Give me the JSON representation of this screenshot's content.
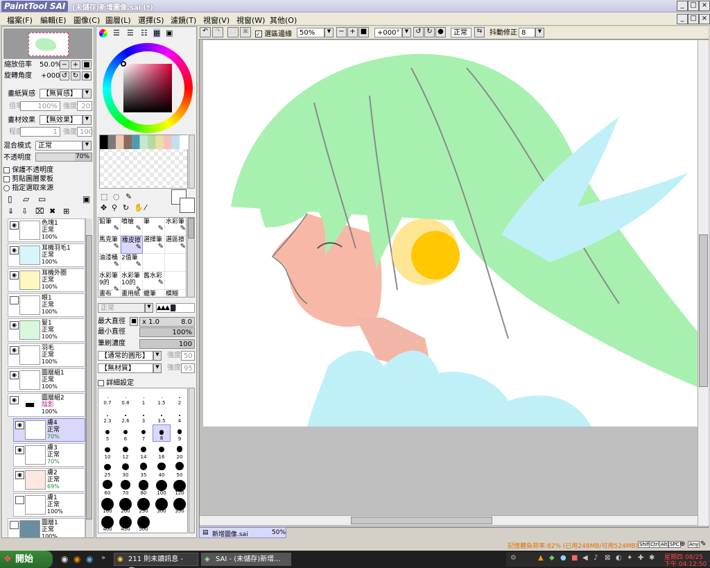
{
  "titlebar": {
    "logo": "PaintTool SAI",
    "title": "(未儲存)新增圖像.sai (*)"
  },
  "menu": [
    "檔案(F)",
    "編輯(E)",
    "圖像(C)",
    "圖層(L)",
    "選擇(S)",
    "濾鏡(T)",
    "視窗(V)",
    "視窗(W)",
    "其他(O)"
  ],
  "navigator": {
    "zoom_label": "縮放倍率",
    "zoom_value": "50.0%",
    "angle_label": "旋轉角度",
    "angle_value": "+000"
  },
  "paper": {
    "texture_label": "畫紙質感",
    "texture_value": "【無質感】",
    "scale_label": "倍率",
    "scale_value": "100%",
    "strength_label": "強度",
    "strength_value": "20",
    "effect_label": "畫材效果",
    "effect_value": "【無效果】",
    "degree_label": "程度",
    "degree_value": "1",
    "strength2_label": "強度",
    "strength2_value": "100"
  },
  "blend": {
    "label": "混合模式",
    "value": "正常",
    "opacity_label": "不透明度",
    "opacity_value": "70%"
  },
  "checks": [
    "保護不透明度",
    "剪貼圖層蒙板",
    "指定選取來源"
  ],
  "layers": [
    {
      "name": "色塊1",
      "mode": "正常",
      "opacity": "100%"
    },
    {
      "name": "耳機羽毛1",
      "mode": "正常",
      "opacity": "100%"
    },
    {
      "name": "耳機外圈",
      "mode": "正常",
      "opacity": "100%"
    },
    {
      "name": "眼1",
      "mode": "正常",
      "opacity": "100%"
    },
    {
      "name": "髮1",
      "mode": "正常",
      "opacity": "100%"
    },
    {
      "name": "羽毛",
      "mode": "正常",
      "opacity": "100%"
    },
    {
      "name": "圖層組1",
      "mode": "正常",
      "opacity": "100%"
    },
    {
      "name": "圖層組2",
      "mode": "陰影",
      "opacity": "100%"
    },
    {
      "name": "膚4",
      "mode": "正常",
      "opacity": "70%"
    },
    {
      "name": "膚3",
      "mode": "正常",
      "opacity": "70%"
    },
    {
      "name": "膚2",
      "mode": "正常",
      "opacity": "69%"
    },
    {
      "name": "膚1",
      "mode": "正常",
      "opacity": "100%"
    },
    {
      "name": "圖層1",
      "mode": "正常",
      "opacity": "100%"
    }
  ],
  "tools": [
    [
      "鉛筆",
      "噴槍",
      "筆",
      "水彩筆"
    ],
    [
      "馬克筆",
      "橡皮擦",
      "選擇筆",
      "選區擦"
    ],
    [
      "油漆桶",
      "2值筆",
      "",
      ""
    ],
    [
      "水彩筆9的",
      "水彩筆10的",
      "舊水彩",
      ""
    ],
    [
      "畫布",
      "畫用紙",
      "蠟筆",
      "模糊"
    ]
  ],
  "brush": {
    "mode": "正常",
    "max_label": "最大直徑",
    "max_mult": "x 1.0",
    "max_value": "8.0",
    "min_label": "最小直徑",
    "min_value": "100%",
    "density_label": "筆刷濃度",
    "density_value": "100",
    "shape": "【通常的圓形】",
    "shape_strength_label": "強度",
    "shape_strength": "50",
    "texture": "【無材質】",
    "texture_strength_label": "強度",
    "texture_strength": "95",
    "detail": "詳細設定"
  },
  "brush_sizes": [
    "0.7",
    "0.8",
    "1",
    "1.5",
    "2",
    "2.3",
    "2.6",
    "3",
    "3.5",
    "4",
    "5",
    "6",
    "7",
    "8",
    "9",
    "10",
    "12",
    "14",
    "16",
    "20",
    "25",
    "30",
    "35",
    "40",
    "50",
    "60",
    "70",
    "80",
    "100",
    "120",
    "160",
    "200",
    "250",
    "300",
    "350",
    "400",
    "450",
    "500"
  ],
  "canvas_toolbar": {
    "select_edge": "選區邊緣",
    "zoom": "50%",
    "angle": "+000°",
    "mode": "正常",
    "stab_label": "抖動修正",
    "stab_value": "8"
  },
  "doc_tab": {
    "name": "新增圖像.sai",
    "zoom": "50%"
  },
  "status": {
    "memory": "記憶體負荷率:82% (已用248MB/可用524MB)",
    "keys": [
      "Shift",
      "Ctrl",
      "Alt",
      "SPC",
      "Any"
    ]
  },
  "taskbar": {
    "start": "開始",
    "task1": "211 則未讀訊息 - 意...",
    "task2": "SAI - (未儲存)新增...",
    "day": "星期四 08/25",
    "time": "下午 04:12:50"
  },
  "colors": {
    "hair": "#a8f0b0",
    "feather": "#bff0f8",
    "skin": "#f7b8a8",
    "ear": "#ffc800",
    "accent": "#6b6fa8"
  }
}
